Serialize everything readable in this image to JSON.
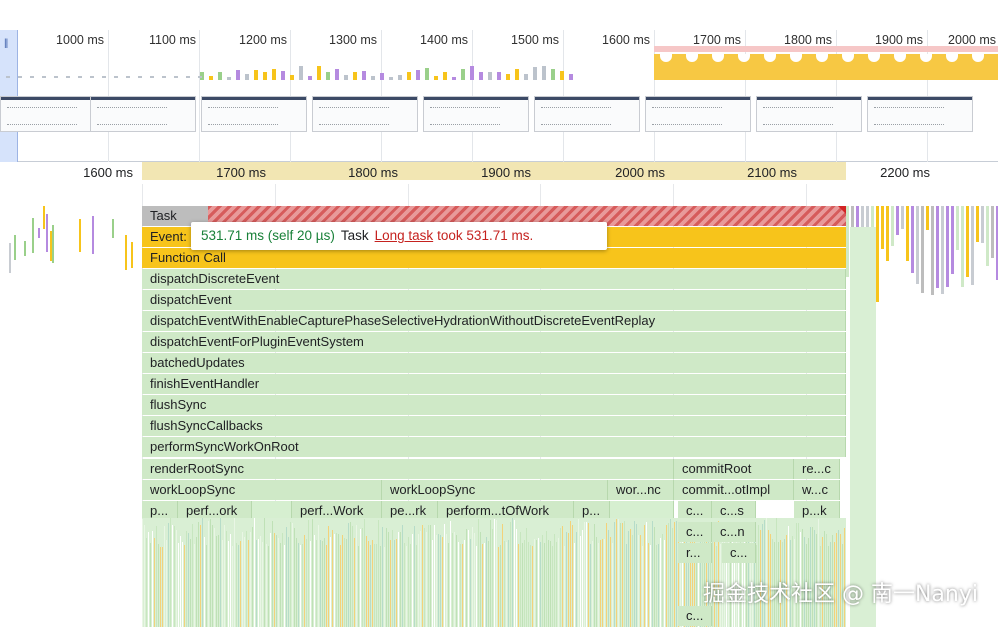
{
  "overview": {
    "tick_labels": [
      "1000 ms",
      "1100 ms",
      "1200 ms",
      "1300 ms",
      "1400 ms",
      "1500 ms",
      "1600 ms",
      "1700 ms",
      "1800 ms",
      "1900 ms",
      "2000 ms"
    ],
    "cpu_color": "#f7c843",
    "selection_color": "#f6c7c7"
  },
  "ruler": {
    "labels": [
      "1600 ms",
      "1700 ms",
      "1800 ms",
      "1900 ms",
      "2000 ms",
      "2100 ms",
      "2200 ms"
    ],
    "selection_color": "#f2e6b3"
  },
  "flame": {
    "task": "Task",
    "event": "Event:",
    "function_call": "Function Call",
    "stack": [
      "dispatchDiscreteEvent",
      "dispatchEvent",
      "dispatchEventWithEnableCapturePhaseSelectiveHydrationWithoutDiscreteEventReplay",
      "dispatchEventForPluginEventSystem",
      "batchedUpdates",
      "finishEventHandler",
      "flushSync",
      "flushSyncCallbacks",
      "performSyncWorkOnRoot"
    ],
    "render_root_sync": "renderRootSync",
    "commit_root": "commitRoot",
    "re_c": "re...c",
    "work_loop_sync_1": "workLoopSync",
    "work_loop_sync_2": "workLoopSync",
    "wor_nc": "wor...nc",
    "commit_otimpl": "commit...otImpl",
    "w_c": "w...c",
    "p_1": "p...",
    "perf_ork": "perf...ork",
    "perf_work": "perf...Work",
    "pe_rk": "pe...rk",
    "perform_tofwork": "perform...tOfWork",
    "p_2": "p...",
    "c_1": "c...",
    "c_s": "c...s",
    "p_k": "p...k",
    "c_2": "c...",
    "c_n": "c...n",
    "r_": "r...",
    "c_3": "c...",
    "c_4": "c...",
    "colors": {
      "task": "#bdbdbd",
      "long_task": "#e89a9a",
      "event": "#f7c41b",
      "script": "#cfe9c7"
    }
  },
  "tooltip": {
    "time": "531.71 ms (self 20 µs)",
    "task": "Task",
    "link": "Long task",
    "rest": "took 531.71 ms."
  },
  "watermark": "掘金技术社区 @ 南一Nanyi"
}
